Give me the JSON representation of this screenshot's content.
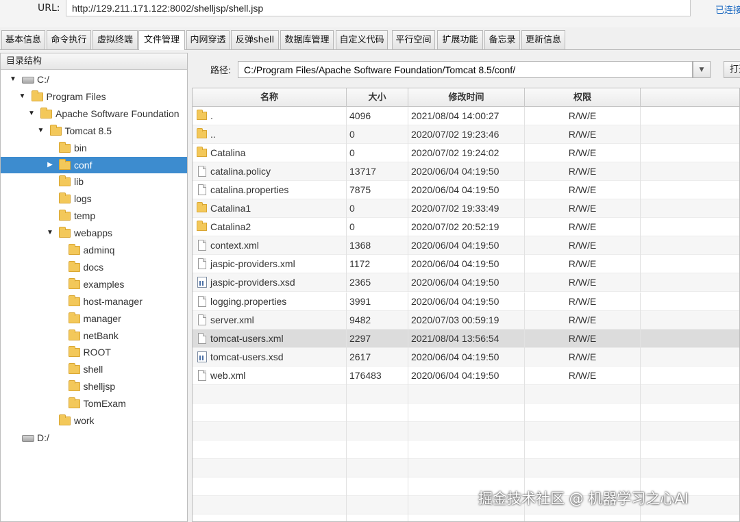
{
  "urlbar": {
    "label": "URL:",
    "value": "http://129.211.171.122:8002/shelljsp/shell.jsp",
    "status": "已连接"
  },
  "tabs": [
    {
      "label": "基本信息"
    },
    {
      "label": "命令执行"
    },
    {
      "label": "虚拟终端"
    },
    {
      "label": "文件管理",
      "active": true
    },
    {
      "label": "内网穿透"
    },
    {
      "label": "反弹shell"
    },
    {
      "label": "数据库管理"
    },
    {
      "label": "自定义代码"
    },
    {
      "label": "平行空间"
    },
    {
      "label": "扩展功能"
    },
    {
      "label": "备忘录"
    },
    {
      "label": "更新信息"
    }
  ],
  "tree": {
    "title": "目录结构",
    "nodes": [
      {
        "label": "C:/",
        "type": "drive",
        "level": 0,
        "expanded": true
      },
      {
        "label": "Program Files",
        "type": "folder",
        "level": 1,
        "expanded": true
      },
      {
        "label": "Apache Software Foundation",
        "type": "folder",
        "level": 2,
        "expanded": true
      },
      {
        "label": "Tomcat 8.5",
        "type": "folder",
        "level": 3,
        "expanded": true
      },
      {
        "label": "bin",
        "type": "folder",
        "level": 4
      },
      {
        "label": "conf",
        "type": "folder",
        "level": 4,
        "collapsed": true,
        "selected": true
      },
      {
        "label": "lib",
        "type": "folder",
        "level": 4
      },
      {
        "label": "logs",
        "type": "folder",
        "level": 4
      },
      {
        "label": "temp",
        "type": "folder",
        "level": 4
      },
      {
        "label": "webapps",
        "type": "folder",
        "level": 4,
        "expanded": true
      },
      {
        "label": "adminq",
        "type": "folder",
        "level": 5
      },
      {
        "label": "docs",
        "type": "folder",
        "level": 5
      },
      {
        "label": "examples",
        "type": "folder",
        "level": 5
      },
      {
        "label": "host-manager",
        "type": "folder",
        "level": 5
      },
      {
        "label": "manager",
        "type": "folder",
        "level": 5
      },
      {
        "label": "netBank",
        "type": "folder",
        "level": 5
      },
      {
        "label": "ROOT",
        "type": "folder",
        "level": 5
      },
      {
        "label": "shell",
        "type": "folder",
        "level": 5
      },
      {
        "label": "shelljsp",
        "type": "folder",
        "level": 5
      },
      {
        "label": "TomExam",
        "type": "folder",
        "level": 5
      },
      {
        "label": "work",
        "type": "folder",
        "level": 4
      },
      {
        "label": "D:/",
        "type": "drive",
        "level": 0
      }
    ]
  },
  "path": {
    "label": "路径:",
    "value": "C:/Program Files/Apache Software Foundation/Tomcat 8.5/conf/",
    "open_button": "打开"
  },
  "table": {
    "columns": [
      "名称",
      "大小",
      "修改时间",
      "权限"
    ],
    "rows": [
      {
        "name": ".",
        "size": "4096",
        "time": "2021/08/04 14:00:27",
        "perm": "R/W/E",
        "icon": "folder"
      },
      {
        "name": "..",
        "size": "0",
        "time": "2020/07/02 19:23:46",
        "perm": "R/W/E",
        "icon": "folder"
      },
      {
        "name": "Catalina",
        "size": "0",
        "time": "2020/07/02 19:24:02",
        "perm": "R/W/E",
        "icon": "folder"
      },
      {
        "name": "catalina.policy",
        "size": "13717",
        "time": "2020/06/04 04:19:50",
        "perm": "R/W/E",
        "icon": "file"
      },
      {
        "name": "catalina.properties",
        "size": "7875",
        "time": "2020/06/04 04:19:50",
        "perm": "R/W/E",
        "icon": "file"
      },
      {
        "name": "Catalina1",
        "size": "0",
        "time": "2020/07/02 19:33:49",
        "perm": "R/W/E",
        "icon": "folder"
      },
      {
        "name": "Catalina2",
        "size": "0",
        "time": "2020/07/02 20:52:19",
        "perm": "R/W/E",
        "icon": "folder"
      },
      {
        "name": "context.xml",
        "size": "1368",
        "time": "2020/06/04 04:19:50",
        "perm": "R/W/E",
        "icon": "file"
      },
      {
        "name": "jaspic-providers.xml",
        "size": "1172",
        "time": "2020/06/04 04:19:50",
        "perm": "R/W/E",
        "icon": "file"
      },
      {
        "name": "jaspic-providers.xsd",
        "size": "2365",
        "time": "2020/06/04 04:19:50",
        "perm": "R/W/E",
        "icon": "xsd"
      },
      {
        "name": "logging.properties",
        "size": "3991",
        "time": "2020/06/04 04:19:50",
        "perm": "R/W/E",
        "icon": "file"
      },
      {
        "name": "server.xml",
        "size": "9482",
        "time": "2020/07/03 00:59:19",
        "perm": "R/W/E",
        "icon": "file"
      },
      {
        "name": "tomcat-users.xml",
        "size": "2297",
        "time": "2021/08/04 13:56:54",
        "perm": "R/W/E",
        "icon": "file",
        "highlighted": true
      },
      {
        "name": "tomcat-users.xsd",
        "size": "2617",
        "time": "2020/06/04 04:19:50",
        "perm": "R/W/E",
        "icon": "xsd"
      },
      {
        "name": "web.xml",
        "size": "176483",
        "time": "2020/06/04 04:19:50",
        "perm": "R/W/E",
        "icon": "file"
      }
    ]
  },
  "watermark": "掘金技术社区 @ 机器学习之心AI",
  "colors": {
    "selection": "#3d8ccf",
    "status_link": "#1565c0",
    "folder": "#f3c85a"
  }
}
